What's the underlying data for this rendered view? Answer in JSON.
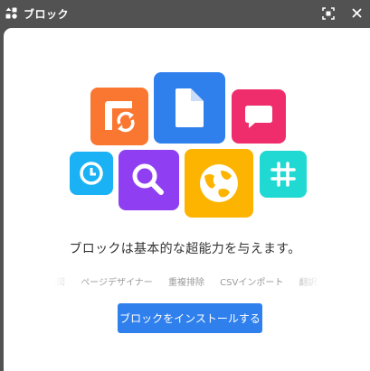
{
  "window": {
    "title": "ブロック"
  },
  "main": {
    "tagline": "ブロックは基本的な超能力を与えます。",
    "features": [
      "地図",
      "ページデザイナー",
      "重複排除",
      "CSVインポート",
      "翻訳"
    ],
    "install_button": "ブロックをインストールする"
  },
  "tiles": [
    {
      "name": "refresh-block-icon",
      "color": "#f97730"
    },
    {
      "name": "document-icon",
      "color": "#2f80ed"
    },
    {
      "name": "chat-bubble-icon",
      "color": "#ef2d6c"
    },
    {
      "name": "clock-icon",
      "color": "#1ab2f4"
    },
    {
      "name": "search-icon",
      "color": "#8f3ff1"
    },
    {
      "name": "globe-icon",
      "color": "#fcb400"
    },
    {
      "name": "hashtag-icon",
      "color": "#20d9d2"
    }
  ]
}
